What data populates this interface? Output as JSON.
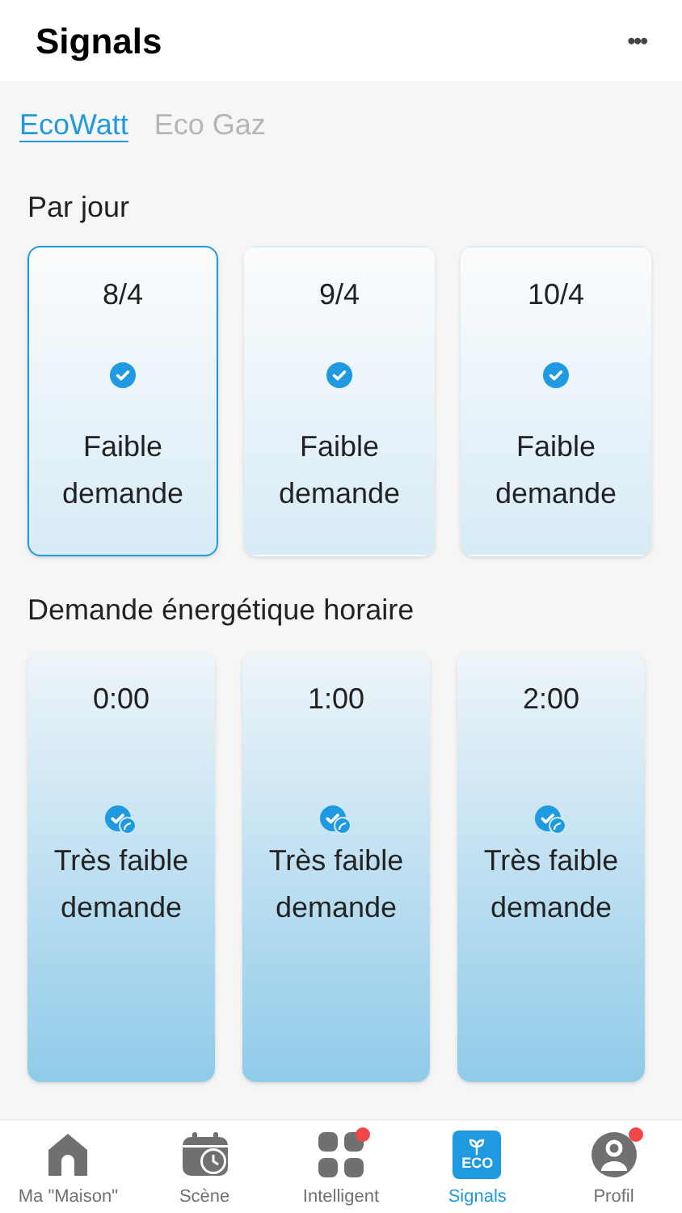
{
  "header": {
    "title": "Signals",
    "menu": "•••"
  },
  "tabs": [
    {
      "label": "EcoWatt",
      "selected": true
    },
    {
      "label": "Eco Gaz",
      "selected": false
    }
  ],
  "daily": {
    "title": "Par jour",
    "cards": [
      {
        "date": "8/4",
        "status": "Faible demande",
        "selected": true
      },
      {
        "date": "9/4",
        "status": "Faible demande",
        "selected": false
      },
      {
        "date": "10/4",
        "status": "Faible demande",
        "selected": false
      }
    ]
  },
  "hourly": {
    "title": "Demande énergétique horaire",
    "cards": [
      {
        "time": "0:00",
        "status": "Très faible demande"
      },
      {
        "time": "1:00",
        "status": "Très faible demande"
      },
      {
        "time": "2:00",
        "status": "Très faible demande"
      }
    ]
  },
  "nav": [
    {
      "kind": "home",
      "label": "Ma \"Maison\"",
      "selected": false,
      "badge": false
    },
    {
      "kind": "scene",
      "label": "Scène",
      "selected": false,
      "badge": false
    },
    {
      "kind": "grid",
      "label": "Intelligent",
      "selected": false,
      "badge": true
    },
    {
      "kind": "eco",
      "label": "Signals",
      "icon_text": "ECO",
      "selected": true,
      "badge": false
    },
    {
      "kind": "profile",
      "label": "Profil",
      "selected": false,
      "badge": true
    }
  ]
}
